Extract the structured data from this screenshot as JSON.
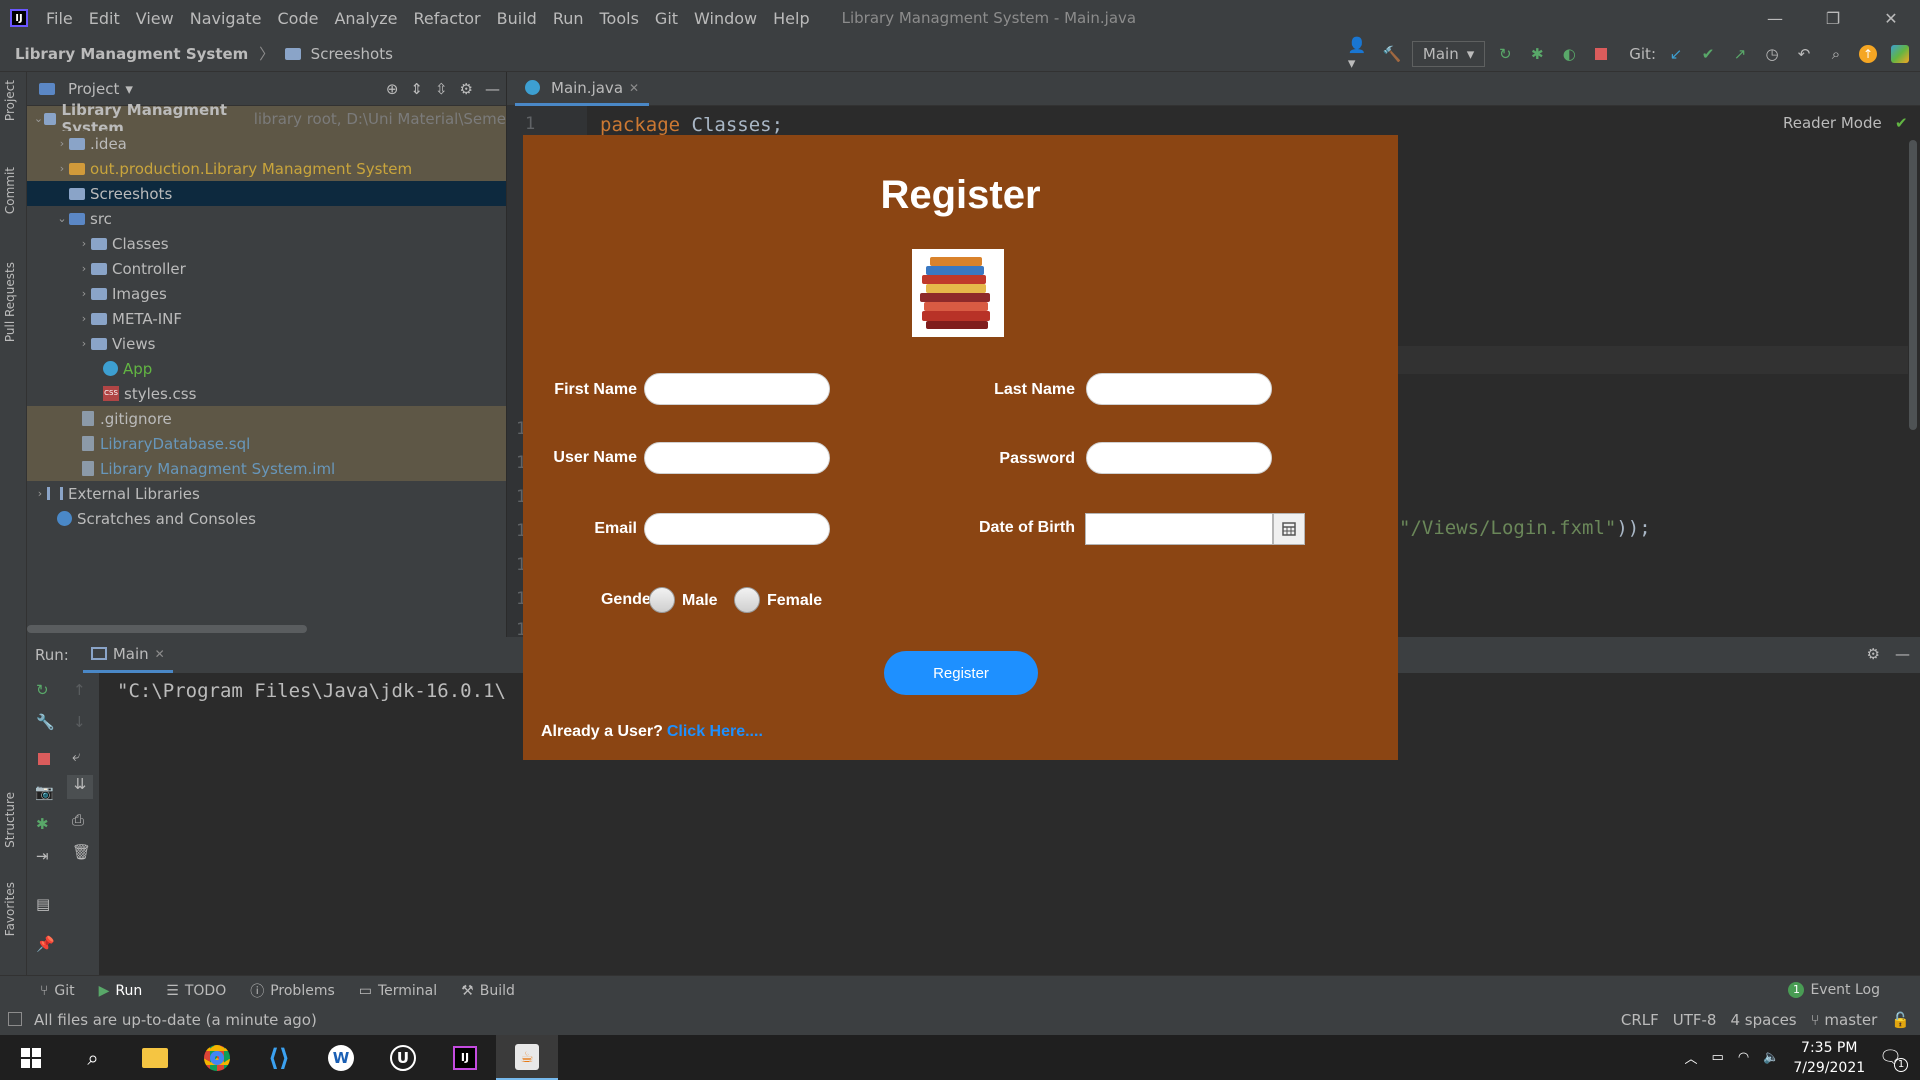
{
  "menubar": {
    "items": [
      {
        "label": "File"
      },
      {
        "label": "Edit"
      },
      {
        "label": "View"
      },
      {
        "label": "Navigate"
      },
      {
        "label": "Code"
      },
      {
        "label": "Analyze"
      },
      {
        "label": "Refactor"
      },
      {
        "label": "Build"
      },
      {
        "label": "Run"
      },
      {
        "label": "Tools"
      },
      {
        "label": "Git"
      },
      {
        "label": "Window"
      },
      {
        "label": "Help"
      }
    ],
    "window_title": "Library Managment System - Main.java",
    "logo_text": "IJ"
  },
  "window_controls": {
    "minimize": "—",
    "restore": "❐",
    "close": "✕"
  },
  "navbar": {
    "project": "Library Managment System",
    "folder": "Screeshots"
  },
  "toolbar": {
    "run_config": "Main",
    "git_label": "Git:"
  },
  "left_strip": {
    "project": "Project",
    "commit": "Commit",
    "pull_requests": "Pull Requests",
    "structure": "Structure",
    "favorites": "Favorites"
  },
  "project_panel": {
    "title": "Project",
    "tree": [
      {
        "label": "Library Managment System",
        "hint": "library root,  D:\\Uni Material\\Seme"
      },
      {
        "label": ".idea"
      },
      {
        "label": "out.production.Library Managment System"
      },
      {
        "label": "Screeshots"
      },
      {
        "label": "src"
      },
      {
        "label": "Classes"
      },
      {
        "label": "Controller"
      },
      {
        "label": "Images"
      },
      {
        "label": "META-INF"
      },
      {
        "label": "Views"
      },
      {
        "label": "App"
      },
      {
        "label": "styles.css"
      },
      {
        "label": ".gitignore"
      },
      {
        "label": "LibraryDatabase.sql"
      },
      {
        "label": "Library Managment System.iml"
      },
      {
        "label": "External Libraries"
      },
      {
        "label": "Scratches and Consoles"
      }
    ]
  },
  "editor": {
    "tab": "Main.java",
    "line1_number": "1",
    "line1_keyword": "package",
    "line1_rest": " Classes;",
    "line2_string": "\"/Views/Login.fxml\"",
    "line2_rest": "));",
    "reader_mode": "Reader Mode",
    "gutter_numbers": [
      "1",
      "1",
      "1",
      "1",
      "1",
      "1",
      "1"
    ]
  },
  "run_panel": {
    "label": "Run:",
    "tab": "Main",
    "console": "\"C:\\Program Files\\Java\\jdk-16.0.1\\"
  },
  "bottom_tabs": [
    {
      "label": "Git"
    },
    {
      "label": "Run"
    },
    {
      "label": "TODO"
    },
    {
      "label": "Problems"
    },
    {
      "label": "Terminal"
    },
    {
      "label": "Build"
    }
  ],
  "event_log": {
    "badge": "1",
    "label": "Event Log"
  },
  "statusbar": {
    "message": "All files are up-to-date (a minute ago)",
    "line_sep": "CRLF",
    "encoding": "UTF-8",
    "indent": "4 spaces",
    "branch": "master"
  },
  "taskbar": {
    "time": "7:35 PM",
    "date": "7/29/2021",
    "notif_count": "1"
  },
  "register": {
    "title": "Register",
    "first_name_label": "First Name",
    "last_name_label": "Last Name",
    "user_name_label": "User Name",
    "password_label": "Password",
    "email_label": "Email",
    "dob_label": "Date of Birth",
    "gender_label": "Gender",
    "male_label": "Male",
    "female_label": "Female",
    "button_label": "Register",
    "already_text": "Already a User?",
    "click_here": "Click Here...."
  },
  "colors": {
    "dialog_bg": "#8b4513",
    "accent": "#1e90ff",
    "ide_bg": "#2b2b2b",
    "panel_bg": "#3c3f41"
  }
}
